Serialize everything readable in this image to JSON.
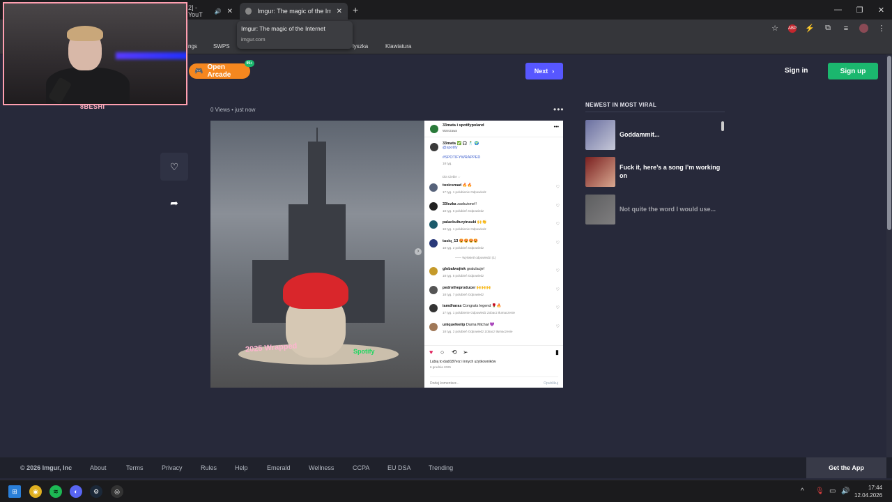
{
  "browser": {
    "tabs": [
      {
        "title": "2] - YouT",
        "close": "✕"
      },
      {
        "title": "Imgur: The magic of the Interne",
        "close": "✕"
      }
    ],
    "new_tab": "+",
    "tooltip": {
      "title": "Imgur: The magic of the Internet",
      "url": "imgur.com"
    },
    "bookmarks": [
      "ngs",
      "SWPS",
      "lyszka",
      "Klawiatura"
    ],
    "window_controls": [
      "—",
      "❐",
      "✕"
    ],
    "extension_abp": "ABP"
  },
  "webcam": {
    "label": "8BESHI"
  },
  "imgur": {
    "open_arcade": "Open Arcade",
    "arcade_badge": "99+",
    "next": "Next",
    "sign_in": "Sign in",
    "sign_up": "Sign up",
    "post_meta": "0 Views • just now",
    "newest_title": "NEWEST IN MOST VIRAL",
    "viral": [
      {
        "title": "Goddammit..."
      },
      {
        "title": "Fuck it, here’s a song I’m working on"
      },
      {
        "title": "Not quite the word I would use..."
      }
    ]
  },
  "insta": {
    "header_user": "33mata i spotifypoland",
    "header_loc": "Warszawa",
    "cap_user": "33mata",
    "cap_handle": "@spotify",
    "cap_tag": "#SPOTIFYWRAPPED",
    "cap_time": "18 tyg.",
    "sub": "Dla Ciebie ⌵",
    "comments": [
      {
        "user": "toxicsmad",
        "text": "🔥🔥",
        "meta": "17 tyg.   1 polubienie   Odpowiedz"
      },
      {
        "user": "33lezka",
        "text": "zasłużone!!",
        "meta": "18 tyg.   6 polubień   Odpowiedz"
      },
      {
        "user": "palackulturyinauki",
        "text": "🙌👏",
        "meta": "18 tyg.   1 polubienie   Odpowiedz"
      },
      {
        "user": "tusiq_13",
        "text": "😍😍😍😍",
        "meta": "18 tyg.   2 polubień   Odpowiedz"
      },
      {
        "user": "globalwojtek",
        "text": "gratulacje!",
        "meta": "18 tyg.   5 polubień   Odpowiedz"
      },
      {
        "user": "pedrotheproducer",
        "text": "🙌🙌🙌",
        "meta": "18 tyg.   7 polubień   Odpowiedz"
      },
      {
        "user": "iamdharas",
        "text": "Congrats legend 🌹🔥",
        "meta": "17 tyg.   1 polubienie   Odpowiedz   Zobacz tłumaczenie"
      },
      {
        "user": "uniquefeelip",
        "text": "Duma Michał 💜",
        "meta": "18 tyg.   2 polubień   Odpowiedz   Zobacz tłumaczenie"
      }
    ],
    "show_replies": "—— Wyświetl odpowiedzi (1)",
    "likes": "Lubią to dadi187erz i innych użytkowników",
    "date": "6 grudnia 2025",
    "add_comment": "Dodaj komentarz...",
    "publish": "Opublikuj",
    "photo_text_wrapped": "2025 Wrapped",
    "photo_text_spotify": "Spotify"
  },
  "footer": {
    "copyright": "© 2026 Imgur, Inc",
    "links": [
      "About",
      "Terms",
      "Privacy",
      "Rules",
      "Help",
      "Emerald",
      "Wellness",
      "CCPA",
      "EU DSA",
      "Trending"
    ],
    "get_app": "Get the App"
  },
  "taskbar": {
    "time": "17:44",
    "date": "12.04.2026"
  },
  "colors": {
    "imgur_bg": "#27293a",
    "next_blue": "#5757ff",
    "signup_green": "#1bb76e",
    "arcade_orange": "#f5871f"
  }
}
